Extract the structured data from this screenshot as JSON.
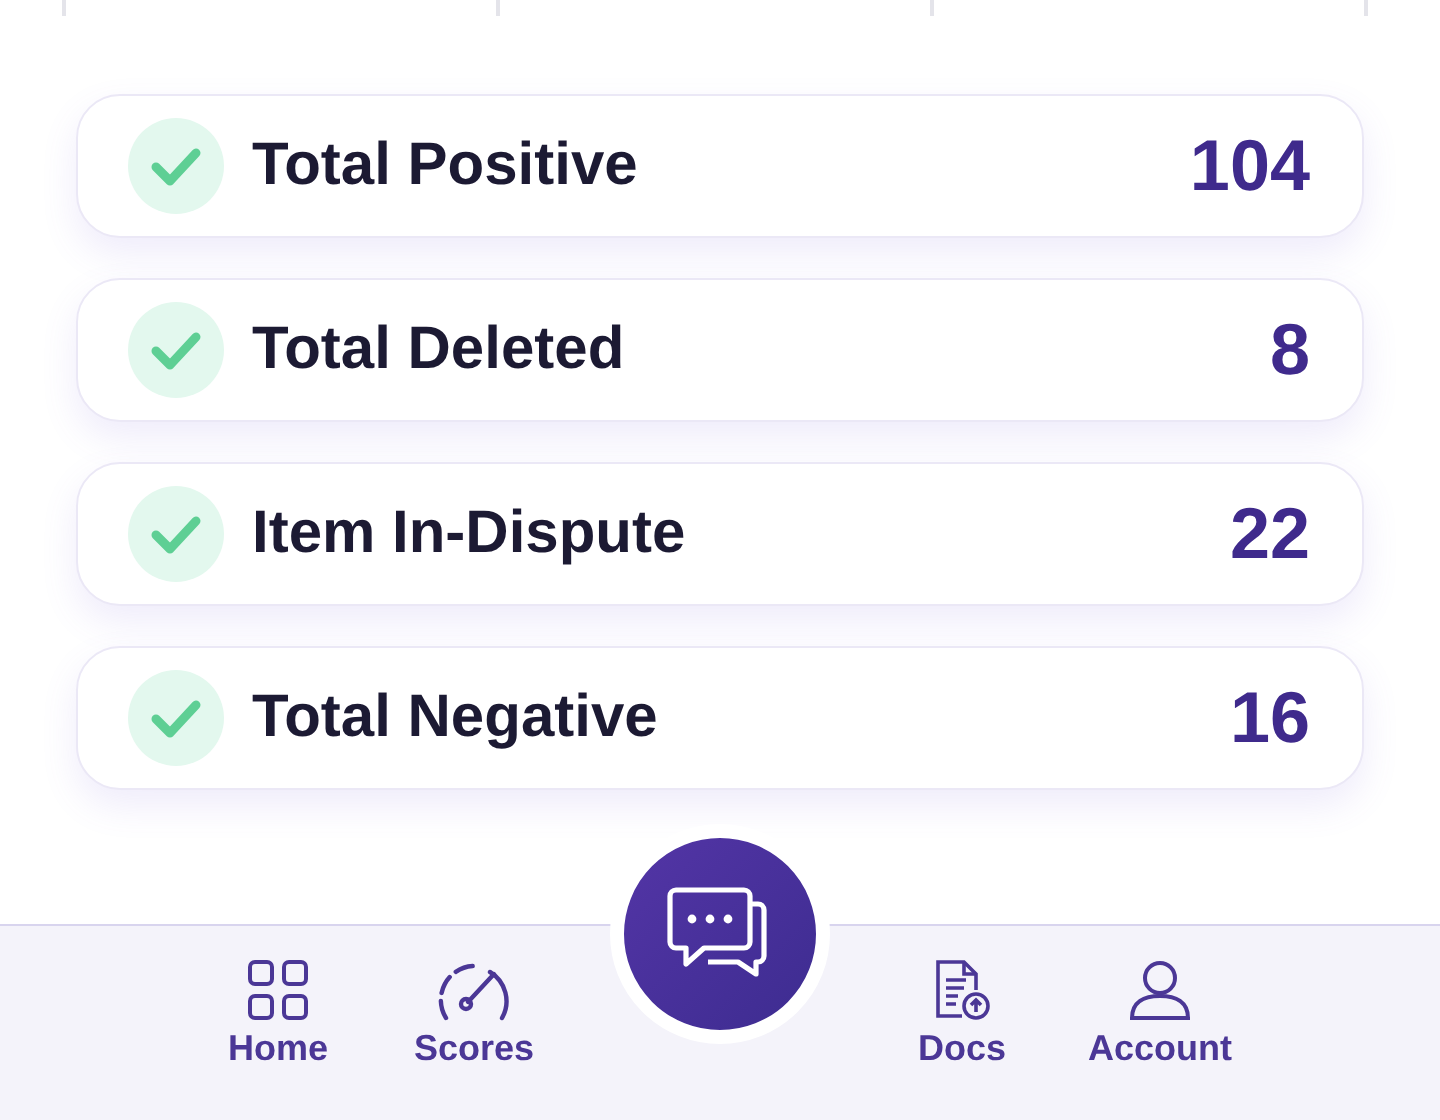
{
  "stats": [
    {
      "label": "Total Positive",
      "value": "104",
      "checked": true
    },
    {
      "label": "Total Deleted",
      "value": "8",
      "checked": true
    },
    {
      "label": "Item In-Dispute",
      "value": "22",
      "checked": true
    },
    {
      "label": "Total Negative",
      "value": "16",
      "checked": true
    }
  ],
  "nav": [
    {
      "label": "Home",
      "kind": "grid"
    },
    {
      "label": "Scores",
      "kind": "gauge"
    },
    {
      "label": "Docs",
      "kind": "doc"
    },
    {
      "label": "Account",
      "kind": "person"
    }
  ]
}
